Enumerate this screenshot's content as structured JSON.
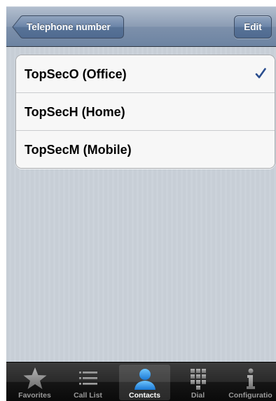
{
  "navbar": {
    "back_label": "Telephone number",
    "edit_label": "Edit"
  },
  "phone_list": {
    "items": [
      {
        "label": "TopSecO (Office)",
        "selected": true
      },
      {
        "label": "TopSecH (Home)",
        "selected": false
      },
      {
        "label": "TopSecM (Mobile)",
        "selected": false
      }
    ],
    "check_icon": "checkmark-icon",
    "accent_color": "#2b4e8f"
  },
  "tabbar": {
    "tabs": [
      {
        "label": "Favorites",
        "icon": "star-icon",
        "selected": false
      },
      {
        "label": "Call List",
        "icon": "list-icon",
        "selected": false
      },
      {
        "label": "Contacts",
        "icon": "person-icon",
        "selected": true
      },
      {
        "label": "Dial",
        "icon": "keypad-icon",
        "selected": false
      },
      {
        "label": "Configuratio",
        "icon": "info-icon",
        "selected": false
      }
    ],
    "selected_color": "#3aa0e8"
  }
}
